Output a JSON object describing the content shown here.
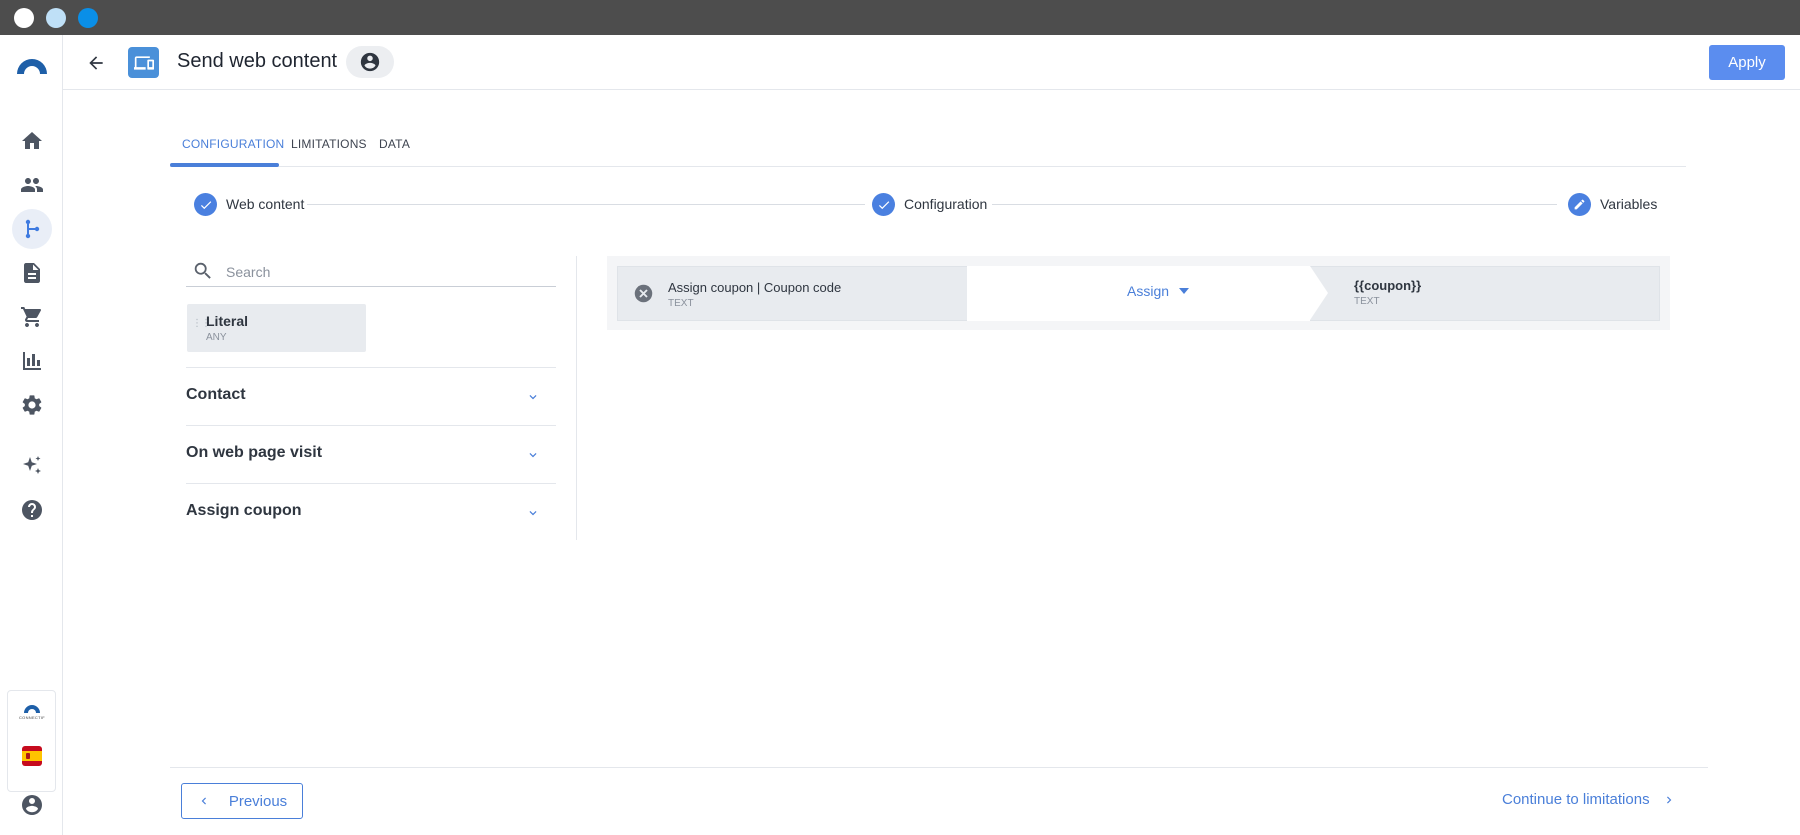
{
  "window": {
    "controls": [
      {
        "name": "close",
        "color": "#ffffff"
      },
      {
        "name": "minimize",
        "color": "#bfe0f7"
      },
      {
        "name": "maximize",
        "color": "#0a8fe8"
      }
    ]
  },
  "sidebar": {
    "items": [
      {
        "icon": "home-icon"
      },
      {
        "icon": "contacts-icon"
      },
      {
        "icon": "workflow-icon",
        "active": true
      },
      {
        "icon": "document-icon"
      },
      {
        "icon": "cart-icon"
      },
      {
        "icon": "analytics-icon"
      },
      {
        "icon": "settings-icon"
      },
      {
        "icon": "sparkle-icon"
      },
      {
        "icon": "help-icon"
      }
    ],
    "brand_text": "CONNECTIF",
    "language_flag": "es"
  },
  "header": {
    "title": "Send web content",
    "apply_label": "Apply"
  },
  "tabs": [
    {
      "label": "CONFIGURATION",
      "active": true
    },
    {
      "label": "LIMITATIONS",
      "active": false
    },
    {
      "label": "DATA",
      "active": false
    }
  ],
  "stepper": [
    {
      "label": "Web content",
      "state": "done"
    },
    {
      "label": "Configuration",
      "state": "done"
    },
    {
      "label": "Variables",
      "state": "editing"
    }
  ],
  "left_panel": {
    "search_placeholder": "Search",
    "literal": {
      "name": "Literal",
      "type": "ANY"
    },
    "groups": [
      {
        "label": "Contact"
      },
      {
        "label": "On web page visit"
      },
      {
        "label": "Assign coupon"
      }
    ]
  },
  "mapping": {
    "source": {
      "name": "Assign coupon | Coupon code",
      "type": "TEXT"
    },
    "operation": "Assign",
    "target": {
      "name": "{{coupon}}",
      "type": "TEXT"
    }
  },
  "footer": {
    "previous_label": "Previous",
    "continue_label": "Continue to limitations"
  },
  "colors": {
    "accent": "#4a7fd9",
    "apply_button": "#5b8def",
    "titlebar": "#4d4d4d"
  }
}
